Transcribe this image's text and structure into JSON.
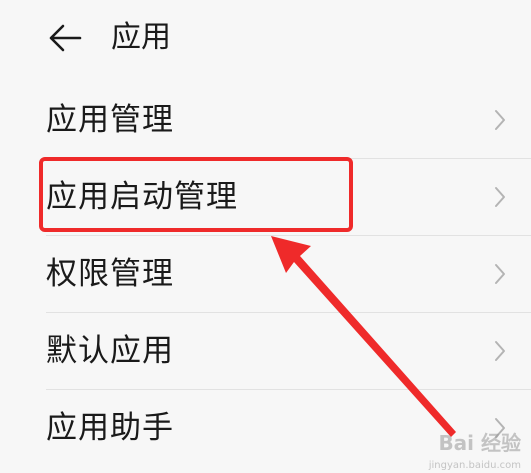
{
  "header": {
    "title": "应用",
    "back_icon": "back-arrow-icon"
  },
  "menu": {
    "items": [
      {
        "label": "应用管理",
        "icon": "chevron-right-icon"
      },
      {
        "label": "应用启动管理",
        "icon": "chevron-right-icon",
        "highlighted": true
      },
      {
        "label": "权限管理",
        "icon": "chevron-right-icon"
      },
      {
        "label": "默认应用",
        "icon": "chevron-right-icon"
      },
      {
        "label": "应用助手",
        "icon": "chevron-right-icon"
      }
    ]
  },
  "annotation": {
    "color": "#ef2a2a"
  },
  "watermark": {
    "main": "Bai 经验",
    "sub": "jingyan.baidu.com"
  }
}
